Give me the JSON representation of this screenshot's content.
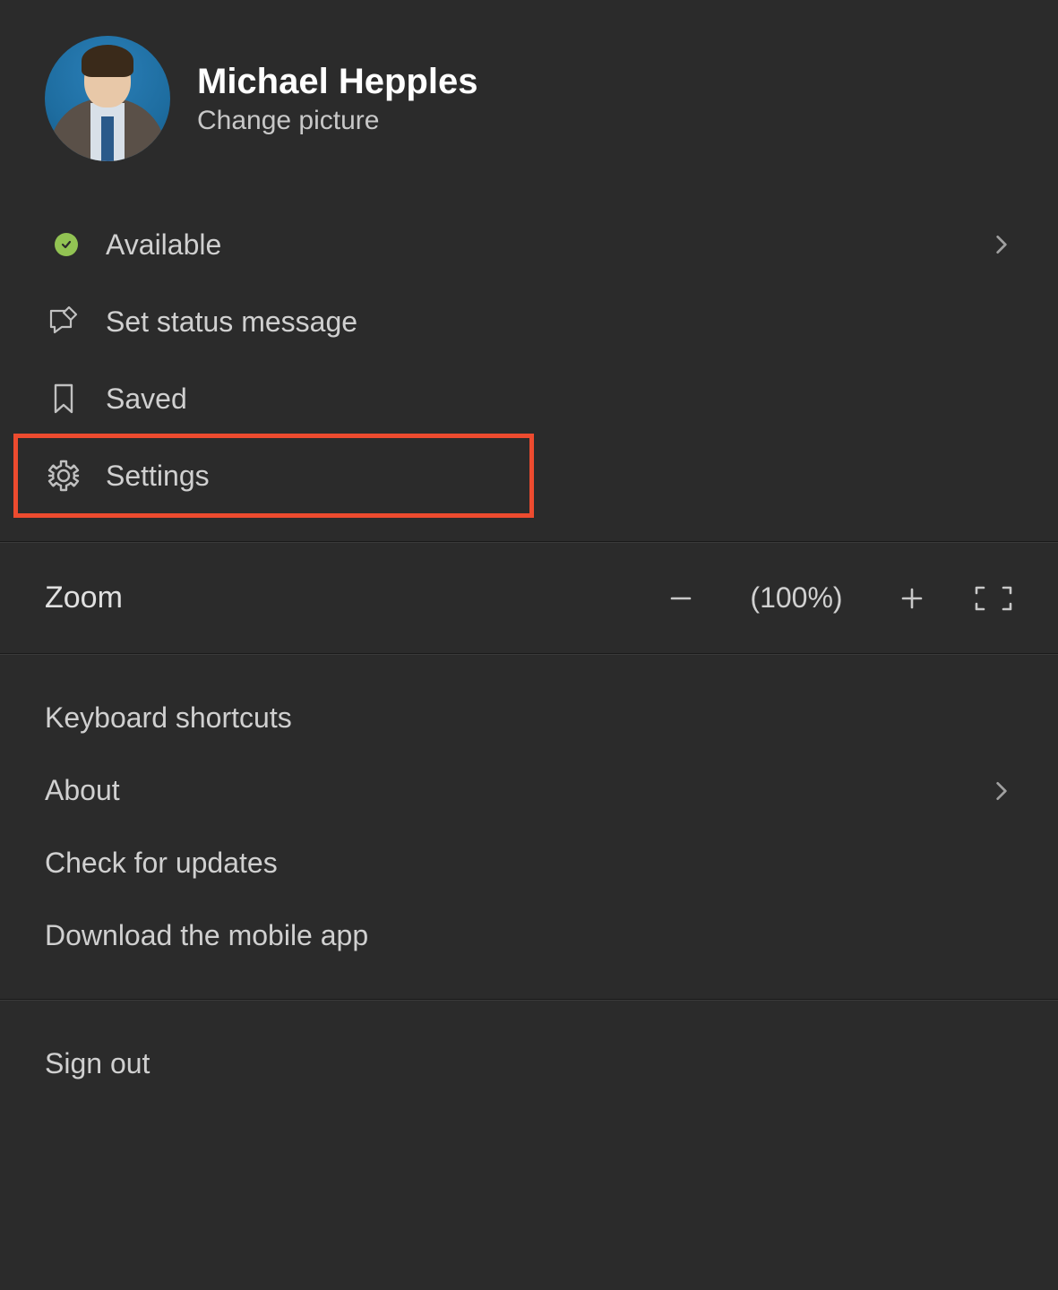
{
  "profile": {
    "name": "Michael Hepples",
    "change_picture_label": "Change picture"
  },
  "status": {
    "presence": "Available",
    "status_color": "#92c353"
  },
  "menu": {
    "set_status_label": "Set status message",
    "saved_label": "Saved",
    "settings_label": "Settings"
  },
  "zoom": {
    "label": "Zoom",
    "level": "(100%)"
  },
  "lower_menu": {
    "keyboard_shortcuts_label": "Keyboard shortcuts",
    "about_label": "About",
    "check_updates_label": "Check for updates",
    "download_app_label": "Download the mobile app"
  },
  "signout": {
    "label": "Sign out"
  },
  "highlight": {
    "target": "settings",
    "color": "#ed4b2f"
  }
}
